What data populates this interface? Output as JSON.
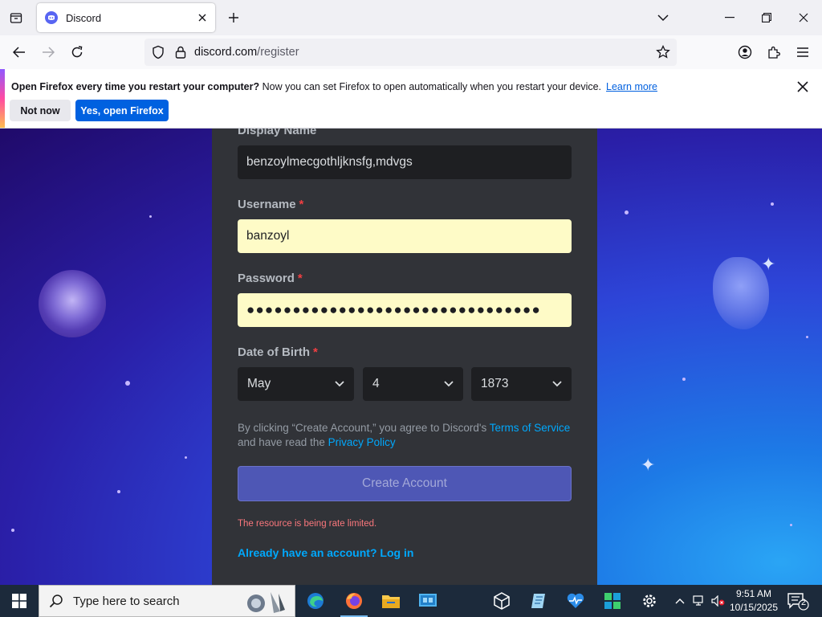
{
  "browser": {
    "tab": {
      "title": "Discord"
    },
    "url": {
      "domain": "discord.com",
      "path": "/register"
    }
  },
  "notification": {
    "bold_text": "Open Firefox every time you restart your computer?",
    "text": " Now you can set Firefox to open automatically when you restart your device.",
    "link": "Learn more",
    "btn_secondary": "Not now",
    "btn_primary": "Yes, open Firefox"
  },
  "form": {
    "display_name": {
      "label": "Display Name",
      "value": "benzoylmecgothljknsfg,mdvgs"
    },
    "username": {
      "label": "Username",
      "required": "*",
      "value": "banzoyl"
    },
    "password": {
      "label": "Password",
      "required": "*",
      "value": "●●●●●●●●●●●●●●●●●●●●●●●●●●●●●●●●"
    },
    "dob": {
      "label": "Date of Birth",
      "required": "*",
      "month": "May",
      "day": "4",
      "year": "1873"
    },
    "terms": {
      "prefix": "By clicking “Create Account,” you agree to Discord's ",
      "tos": "Terms of Service",
      "middle": "and have read the ",
      "privacy": "Privacy Policy"
    },
    "create_button": "Create Account",
    "error": "The resource is being rate limited.",
    "login_link": "Already have an account? Log in"
  },
  "taskbar": {
    "search_placeholder": "Type here to search",
    "time": "9:51 AM",
    "date": "10/15/2025",
    "notification_count": "2"
  },
  "colors": {
    "discord_blurple": "#5865f2",
    "card_bg": "#313338",
    "input_bg": "#1e1f22",
    "autofill_bg": "#fefbc7",
    "link": "#00a8fc",
    "error": "#fa777c",
    "firefox_primary": "#0061e0"
  }
}
